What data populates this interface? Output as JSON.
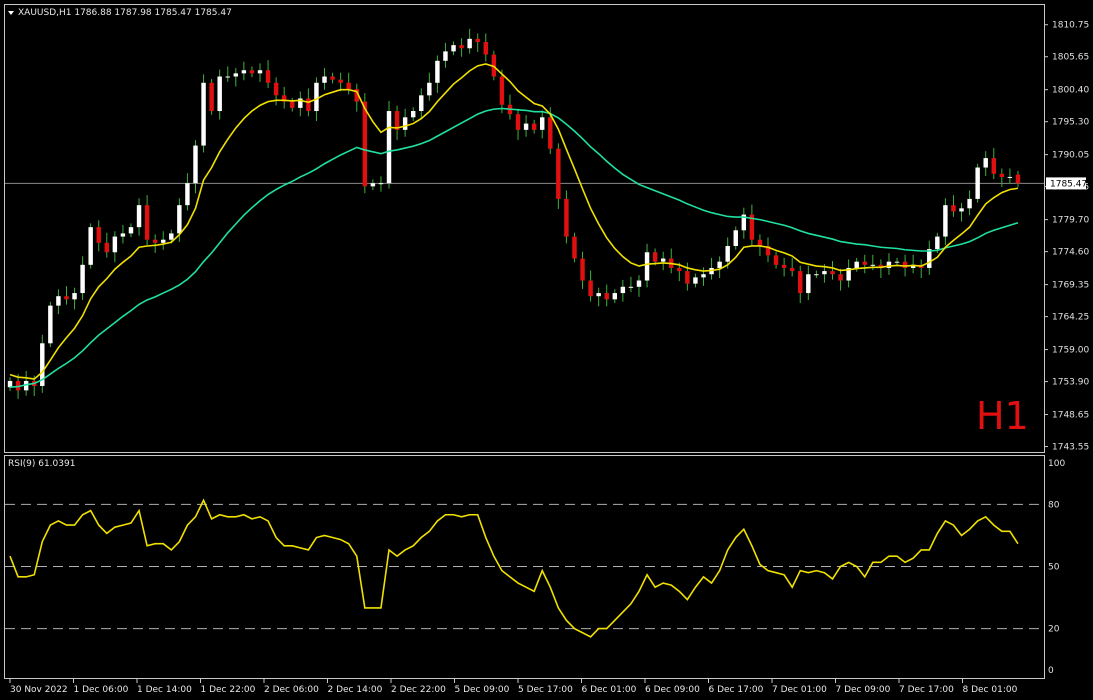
{
  "header": {
    "symbol_line": "XAUUSD,H1  1786.88 1787.98 1785.47 1785.47",
    "timeframe_badge": "H1",
    "current_price_label": "1785.47"
  },
  "rsi_panel": {
    "label": "RSI(9) 61.0391",
    "levels": [
      "100",
      "80",
      "50",
      "20",
      "0"
    ]
  },
  "colors": {
    "background": "#000000",
    "bull_candle": "#ffffff",
    "bear_candle": "#e01010",
    "ma_fast": "#f0e000",
    "ma_slow": "#20e0a0",
    "rsi_line": "#f0e000",
    "grid_dashed": "#b0b0b0",
    "h1_badge": "#e01010"
  },
  "chart_data": [
    {
      "type": "candlestick",
      "title": "XAUUSD,H1",
      "y_ticks": [
        "1810.75",
        "1805.65",
        "1800.40",
        "1795.30",
        "1790.05",
        "1784.95",
        "1779.70",
        "1774.60",
        "1769.35",
        "1764.25",
        "1759.00",
        "1753.90",
        "1748.65",
        "1743.55"
      ],
      "ylim": [
        1743.0,
        1811.5
      ],
      "x_ticks": [
        "30 Nov 2022",
        "1 Dec 06:00",
        "1 Dec 14:00",
        "1 Dec 22:00",
        "2 Dec 06:00",
        "2 Dec 14:00",
        "2 Dec 22:00",
        "5 Dec 09:00",
        "5 Dec 17:00",
        "6 Dec 01:00",
        "6 Dec 09:00",
        "6 Dec 17:00",
        "7 Dec 01:00",
        "7 Dec 09:00",
        "7 Dec 17:00",
        "8 Dec 01:00"
      ],
      "last_price": 1785.47,
      "close": [
        1754.0,
        1752.5,
        1754.0,
        1753.2,
        1760.0,
        1766.0,
        1767.5,
        1767.0,
        1768.0,
        1772.5,
        1778.5,
        1776.0,
        1774.5,
        1777.0,
        1777.5,
        1778.5,
        1782.0,
        1776.5,
        1776.0,
        1776.5,
        1777.5,
        1782.0,
        1785.5,
        1791.5,
        1801.5,
        1797.0,
        1802.5,
        1802.5,
        1803.0,
        1803.5,
        1803.0,
        1803.5,
        1801.5,
        1799.5,
        1798.5,
        1797.5,
        1799.0,
        1797.0,
        1801.5,
        1802.5,
        1802.0,
        1801.5,
        1800.5,
        1798.5,
        1785.0,
        1785.5,
        1785.5,
        1797.0,
        1794.0,
        1796.0,
        1797.0,
        1799.5,
        1801.5,
        1805.0,
        1806.5,
        1807.5,
        1807.0,
        1808.5,
        1808.0,
        1806.0,
        1802.5,
        1798.0,
        1796.5,
        1794.0,
        1795.0,
        1794.0,
        1796.0,
        1791.0,
        1783.0,
        1777.0,
        1773.5,
        1770.0,
        1767.5,
        1768.0,
        1767.0,
        1768.0,
        1769.0,
        1769.0,
        1770.0,
        1774.5,
        1773.0,
        1773.5,
        1772.0,
        1771.5,
        1769.5,
        1770.5,
        1771.0,
        1772.0,
        1773.0,
        1775.5,
        1778.0,
        1780.5,
        1776.5,
        1775.5,
        1774.0,
        1772.5,
        1772.0,
        1771.5,
        1768.0,
        1771.0,
        1771.0,
        1771.5,
        1771.0,
        1770.0,
        1772.0,
        1773.0,
        1772.5,
        1772.5,
        1772.0,
        1773.0,
        1773.0,
        1772.0,
        1772.5,
        1772.0,
        1775.0,
        1777.0,
        1782.0,
        1781.0,
        1781.5,
        1783.0,
        1788.0,
        1789.5,
        1787.0,
        1786.5,
        1786.5,
        1785.47
      ],
      "open": [
        1753.0,
        1754.0,
        1752.5,
        1754.0,
        1753.2,
        1760.0,
        1766.0,
        1767.5,
        1767.0,
        1768.0,
        1772.5,
        1778.5,
        1776.0,
        1774.5,
        1777.0,
        1777.5,
        1778.5,
        1782.0,
        1776.5,
        1776.0,
        1776.5,
        1777.5,
        1782.0,
        1785.5,
        1791.5,
        1801.5,
        1797.0,
        1802.5,
        1802.5,
        1803.0,
        1803.5,
        1803.0,
        1803.5,
        1801.5,
        1799.5,
        1798.5,
        1797.5,
        1799.0,
        1797.0,
        1801.5,
        1802.5,
        1802.0,
        1801.5,
        1800.5,
        1798.5,
        1785.0,
        1785.5,
        1785.5,
        1797.0,
        1794.0,
        1796.0,
        1797.0,
        1799.5,
        1801.5,
        1805.0,
        1806.5,
        1807.5,
        1807.0,
        1808.5,
        1808.0,
        1806.0,
        1802.5,
        1798.0,
        1796.5,
        1794.0,
        1795.0,
        1794.0,
        1796.0,
        1791.0,
        1783.0,
        1777.0,
        1773.5,
        1770.0,
        1767.5,
        1768.0,
        1767.0,
        1768.0,
        1769.0,
        1769.0,
        1770.0,
        1774.5,
        1773.0,
        1773.5,
        1772.0,
        1771.5,
        1769.5,
        1770.5,
        1771.0,
        1772.0,
        1773.0,
        1775.5,
        1778.0,
        1780.5,
        1776.5,
        1775.5,
        1774.0,
        1772.5,
        1772.0,
        1771.5,
        1768.0,
        1771.0,
        1771.0,
        1771.5,
        1771.0,
        1770.0,
        1772.0,
        1773.0,
        1772.5,
        1772.5,
        1772.0,
        1773.0,
        1773.0,
        1772.0,
        1772.5,
        1772.0,
        1775.0,
        1777.0,
        1782.0,
        1781.0,
        1781.5,
        1783.0,
        1788.0,
        1789.5,
        1787.0,
        1786.5,
        1786.88
      ],
      "series": [
        {
          "name": "",
          "values": [
            1755.0,
            1754.6,
            1754.5,
            1754.3,
            1755.4,
            1757.3,
            1759.3,
            1760.9,
            1762.4,
            1764.4,
            1767.1,
            1769.0,
            1770.3,
            1771.8,
            1772.9,
            1773.9,
            1775.3,
            1775.5,
            1775.6,
            1775.8,
            1776.1,
            1777.3,
            1778.9,
            1781.5,
            1786.0,
            1788.0,
            1790.5,
            1792.5,
            1794.3,
            1795.8,
            1797.0,
            1797.9,
            1798.5,
            1798.7,
            1798.7,
            1798.6,
            1798.7,
            1798.4,
            1798.9,
            1799.6,
            1800.0,
            1800.4,
            1800.4,
            1800.1,
            1797.4,
            1795.3,
            1793.6,
            1794.4,
            1794.3,
            1794.6,
            1795.0,
            1795.8,
            1796.9,
            1798.5,
            1799.9,
            1801.3,
            1802.3,
            1803.4,
            1804.2,
            1804.5,
            1804.1,
            1802.9,
            1801.7,
            1800.2,
            1799.2,
            1798.2,
            1797.8,
            1796.5,
            1794.1,
            1790.9,
            1787.8,
            1784.6,
            1781.5,
            1779.0,
            1776.8,
            1775.1,
            1773.8,
            1772.8,
            1772.3,
            1772.6,
            1772.7,
            1772.8,
            1772.7,
            1772.5,
            1772.0,
            1771.7,
            1771.5,
            1771.6,
            1771.8,
            1772.5,
            1773.7,
            1775.3,
            1775.5,
            1775.5,
            1775.3,
            1774.8,
            1774.4,
            1773.9,
            1772.9,
            1772.6,
            1772.3,
            1772.2,
            1772.0,
            1771.6,
            1771.7,
            1771.9,
            1772.0,
            1772.1,
            1772.1,
            1772.3,
            1772.4,
            1772.3,
            1772.4,
            1772.3,
            1772.9,
            1773.7,
            1775.3,
            1776.4,
            1777.4,
            1778.5,
            1780.4,
            1782.2,
            1783.2,
            1784.0,
            1784.5,
            1784.7
          ]
        },
        {
          "name": "",
          "values": [
            1753.0,
            1753.1,
            1753.4,
            1753.6,
            1754.2,
            1755.1,
            1756.0,
            1756.8,
            1757.7,
            1758.8,
            1760.1,
            1761.3,
            1762.3,
            1763.3,
            1764.3,
            1765.2,
            1766.2,
            1766.9,
            1767.4,
            1768.0,
            1768.6,
            1769.3,
            1770.2,
            1771.4,
            1773.0,
            1774.4,
            1776.0,
            1777.6,
            1779.0,
            1780.4,
            1781.6,
            1782.7,
            1783.7,
            1784.5,
            1785.2,
            1785.8,
            1786.5,
            1787.1,
            1787.8,
            1788.6,
            1789.3,
            1790.0,
            1790.6,
            1791.2,
            1790.8,
            1790.5,
            1790.2,
            1790.6,
            1790.8,
            1791.1,
            1791.4,
            1791.8,
            1792.3,
            1793.0,
            1793.7,
            1794.4,
            1795.1,
            1795.8,
            1796.5,
            1797.0,
            1797.3,
            1797.4,
            1797.3,
            1797.2,
            1797.1,
            1796.9,
            1796.9,
            1796.6,
            1795.9,
            1794.9,
            1793.8,
            1792.6,
            1791.3,
            1790.2,
            1789.0,
            1787.9,
            1786.9,
            1786.1,
            1785.3,
            1784.8,
            1784.3,
            1783.8,
            1783.3,
            1782.8,
            1782.2,
            1781.7,
            1781.2,
            1780.8,
            1780.5,
            1780.2,
            1780.1,
            1780.1,
            1779.9,
            1779.7,
            1779.4,
            1779.1,
            1778.8,
            1778.4,
            1777.9,
            1777.5,
            1777.2,
            1776.9,
            1776.6,
            1776.2,
            1776.0,
            1775.8,
            1775.7,
            1775.5,
            1775.3,
            1775.2,
            1775.1,
            1774.9,
            1774.8,
            1774.7,
            1774.7,
            1774.8,
            1775.2,
            1775.5,
            1775.8,
            1776.2,
            1776.8,
            1777.5,
            1778.0,
            1778.4,
            1778.8,
            1779.2
          ]
        }
      ]
    },
    {
      "type": "line",
      "title": "RSI(9) 61.0391",
      "ylim": [
        0,
        100
      ],
      "y_ticks": [
        100,
        80,
        50,
        20,
        0
      ],
      "series": [
        {
          "name": "RSI(9)",
          "values": [
            55,
            45,
            45,
            46,
            62,
            70,
            72,
            70,
            70,
            75,
            77,
            70,
            66,
            69,
            70,
            71,
            77,
            60,
            61,
            61,
            58,
            62,
            70,
            74,
            82,
            73,
            75,
            74,
            74,
            75,
            73,
            74,
            72,
            64,
            60,
            60,
            59,
            58,
            64,
            65,
            64,
            63,
            61,
            55,
            30,
            30,
            30,
            58,
            55,
            58,
            60,
            64,
            67,
            72,
            75,
            75,
            74,
            75,
            75,
            64,
            55,
            48,
            45,
            42,
            40,
            38,
            48,
            40,
            30,
            24,
            20,
            18,
            16,
            20,
            20,
            24,
            28,
            32,
            38,
            46,
            40,
            42,
            41,
            38,
            34,
            40,
            45,
            42,
            48,
            58,
            64,
            68,
            60,
            51,
            48,
            47,
            46,
            40,
            48,
            47,
            48,
            47,
            44,
            50,
            52,
            50,
            45,
            52,
            52,
            55,
            55,
            52,
            54,
            58,
            58,
            66,
            72,
            70,
            65,
            68,
            72,
            74,
            70,
            67,
            67,
            61
          ]
        }
      ]
    }
  ]
}
